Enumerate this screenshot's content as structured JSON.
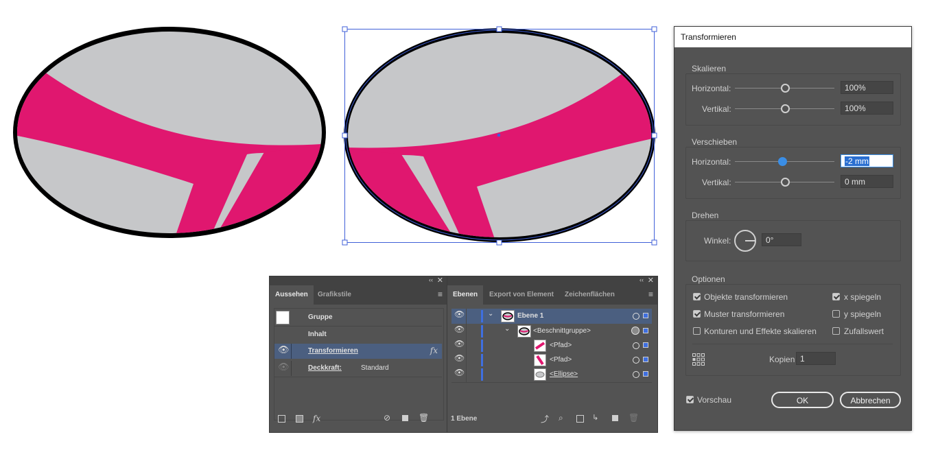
{
  "colors": {
    "pink": "#e0176f",
    "ellipse_fill": "#c6c7c9",
    "ellipse_stroke": "#000000",
    "selection": "#3f5fd8",
    "panel_bg": "#535353",
    "dialog_bg": "#535353",
    "focus_blue": "#3a8ee6"
  },
  "transform_dialog": {
    "title": "Transformieren",
    "scale": {
      "title": "Skalieren",
      "horizontal_label": "Horizontal:",
      "horizontal_value": "100%",
      "vertical_label": "Vertikal:",
      "vertical_value": "100%"
    },
    "move": {
      "title": "Verschieben",
      "horizontal_label": "Horizontal:",
      "horizontal_value": "-2 mm",
      "vertical_label": "Vertikal:",
      "vertical_value": "0 mm"
    },
    "rotate": {
      "title": "Drehen",
      "angle_label": "Winkel:",
      "angle_value": "0°"
    },
    "options": {
      "title": "Optionen",
      "transform_objects": "Objekte transformieren",
      "transform_objects_checked": true,
      "transform_patterns": "Muster transformieren",
      "transform_patterns_checked": true,
      "scale_strokes": "Konturen und Effekte skalieren",
      "scale_strokes_checked": false,
      "reflect_x": "x spiegeln",
      "reflect_x_checked": true,
      "reflect_y": "y spiegeln",
      "reflect_y_checked": false,
      "random": "Zufallswert",
      "random_checked": false,
      "copies_label": "Kopien",
      "copies_value": "1"
    },
    "preview": "Vorschau",
    "preview_checked": true,
    "ok": "OK",
    "cancel": "Abbrechen"
  },
  "appearance_panel": {
    "tabs": [
      "Aussehen",
      "Grafikstile"
    ],
    "rows": {
      "group": "Gruppe",
      "content": "Inhalt",
      "transform": "Transformieren",
      "opacity_label": "Deckkraft:",
      "opacity_value": "Standard"
    },
    "fx_symbol": "fx"
  },
  "layers_panel": {
    "tabs": [
      "Ebenen",
      "Export von Element",
      "Zeichenflächen"
    ],
    "rows": [
      "Ebene 1",
      "<Beschnittgruppe>",
      "<Pfad>",
      "<Pfad>",
      "<Ellipse>"
    ],
    "footer": "1 Ebene"
  }
}
